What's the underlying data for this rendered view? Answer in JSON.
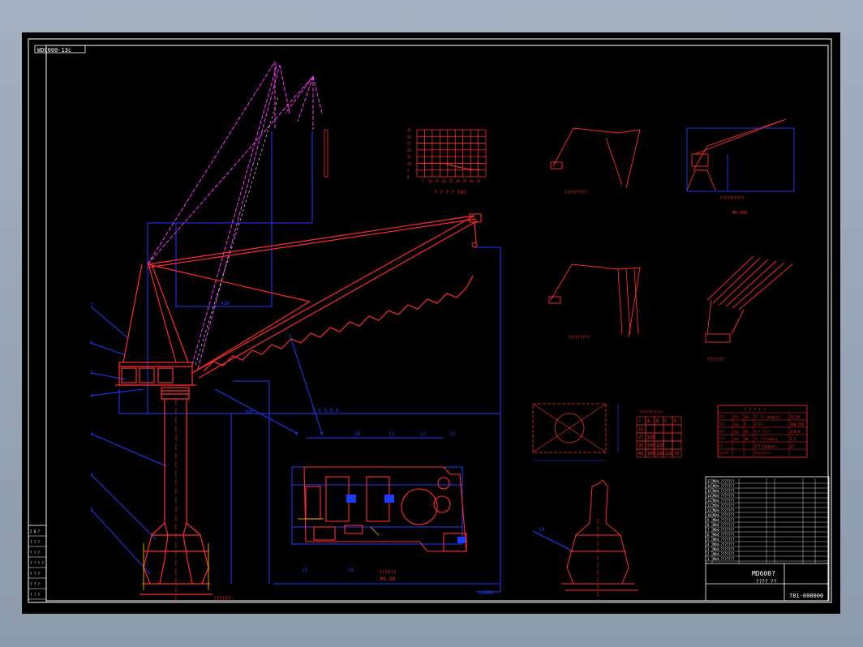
{
  "title_tag": "WDC000-13c",
  "scale_labels": {
    "elevation": "??????",
    "elevation_scale": "M1:50",
    "plan": "??????",
    "plan_scale": "M1:50",
    "chart_title": "? ? ? ?  (m)",
    "detail_a": "?????????",
    "detail_b": "?????????",
    "detail_c": "??????????",
    "detail_c_scale": "M1:500",
    "detail_d": "???????",
    "detail_e": "????????",
    "rear_view": "??????",
    "side_bottom_right": "??????"
  },
  "callouts": [
    "7",
    "6",
    "5",
    "4",
    "3",
    "2",
    "1",
    "8",
    "9",
    "10",
    "11",
    "12",
    "13",
    "14",
    "15",
    "16"
  ],
  "dims": {
    "d1": "430",
    "d2": "280",
    "d3": "5 4 5 0 0",
    "d4": "15000"
  },
  "small_table": {
    "title": "???????????",
    "header": [
      "?",
      "A",
      "B",
      "C",
      "D"
    ],
    "rows": [
      [
        "16",
        "",
        "",
        "",
        ""
      ],
      [
        "25",
        "100",
        "",
        "",
        ""
      ],
      [
        "30",
        "100",
        "120",
        "",
        ""
      ],
      [
        "40",
        "180",
        "180",
        "120",
        "70"
      ]
    ]
  },
  "param_table": {
    "title": "? ? ? ? ?",
    "rows": [
      [
        "???",
        "(t)",
        "10",
        "?? ?? (m/min)",
        "25/50"
      ],
      [
        "???",
        "(m)",
        "5",
        "????",
        "180/250"
      ],
      [
        "???",
        "(m)",
        "45",
        "??? ??/?",
        "3/0.8"
      ],
      [
        "???",
        "(m)",
        "30",
        "?? ??(r/min)",
        "1.5"
      ],
      [
        "??",
        "",
        "",
        "??? (m/min)",
        "25"
      ],
      [
        "?????",
        "",
        "",
        "????????",
        ""
      ]
    ]
  },
  "bom": {
    "rows": [
      "MD4-???????",
      "MD4-???????",
      "MD4-???????",
      "MD4-???????",
      "MD4-???????",
      "MD4-???????",
      "MD4-???????",
      "MD4-???????",
      "MD4-???????",
      "MD4-???????",
      "MD4-???????",
      "MD4-???????",
      "MD4-???????",
      "MD4-???????",
      "MD4-???????",
      "MD4-???????",
      "MD4-???????"
    ],
    "title_big": "MD600?",
    "title_sub": "???? ??",
    "drawing_no": "781-000000"
  },
  "left_strip": [
    "2 0 ?",
    "? ? ?",
    "? ? ?",
    "? ? ? ?",
    "? ? ?",
    "? ? ?",
    "? ? ?"
  ],
  "chart_data": {
    "type": "line",
    "title": "? ? ? ?  (m)",
    "x": [
      5,
      10,
      15,
      20,
      25,
      30,
      35,
      40,
      45
    ],
    "series": [
      {
        "values": [
          10,
          10,
          10,
          10,
          8.5,
          7.2,
          6.2,
          5.3,
          5
        ]
      }
    ],
    "xlim": [
      0,
      50
    ],
    "ylim": [
      0,
      35
    ]
  },
  "colors": {
    "bg": "#000000",
    "frame": "#ffffff",
    "primary": "#ff2b2b",
    "secondary": "#1e3cff",
    "accent": "#ff33ff",
    "gold": "#ffcc00"
  }
}
